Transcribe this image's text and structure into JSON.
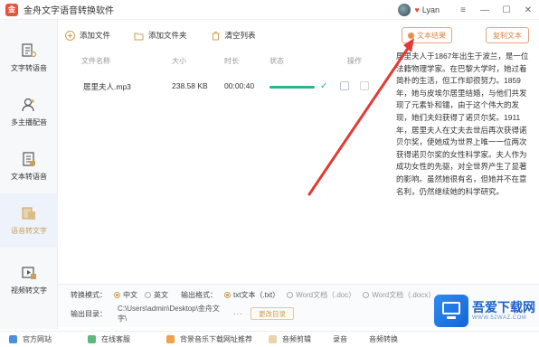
{
  "app": {
    "title": "金舟文字语音转换软件",
    "logo_glyph": "金",
    "username": "Lyan",
    "window_controls": {
      "menu": "≡",
      "minimize": "—",
      "maximize": "☐",
      "close": "✕"
    }
  },
  "sidebar": {
    "items": [
      {
        "label": "文字转语音",
        "icon": "text-to-speech-icon"
      },
      {
        "label": "多主播配音",
        "icon": "multi-anchor-icon"
      },
      {
        "label": "文本转语音",
        "icon": "text-file-icon"
      },
      {
        "label": "语音转文字",
        "icon": "speech-to-text-icon",
        "active": true
      },
      {
        "label": "视频转文字",
        "icon": "video-to-text-icon"
      }
    ]
  },
  "toolbar": {
    "add_file": "添加文件",
    "add_folder": "添加文件夹",
    "clear_list": "清空列表",
    "text_result": "文本结果",
    "copy_text": "复制文本"
  },
  "table": {
    "headers": [
      "文件名称",
      "大小",
      "时长",
      "状态",
      "操作"
    ],
    "rows": [
      {
        "name": "居里夫人.mp3",
        "size": "238.58 KB",
        "duration": "00:00:40",
        "progress": 1.0
      }
    ]
  },
  "result_text": "居里夫人于1867年出生于波兰，是一位法籍物理学家。在巴黎大学时，她过着简朴的生活，但工作却很努力。1859年，她与皮埃尔居里结婚，与他们共发现了元素钋和镭，由于这个伟大的发现，她们夫妇获得了诺贝尔奖。1911年，居里夫人在丈夫去世后再次获得诺贝尔奖，使她成为世界上唯一一位两次获得诺贝尔奖的女性科学家。夫人作为成功女性的先驱，对全世界产生了显著的影响。虽然她很有名，但她并不在意名利，仍然继续她的科学研究。",
  "settings": {
    "convert_mode_label": "转换模式：",
    "mode_chinese": "中文",
    "mode_english": "英文",
    "output_format_label": "输出格式：",
    "format_txt": "txt文本（.txt）",
    "format_doc": "Word文档（.doc）",
    "format_docx": "Word文档（.docx）",
    "output_dir_label": "输出目录：",
    "output_path": "C:\\Users\\admin\\Desktop\\金舟文字\\",
    "more": "···",
    "change_dir": "更改目录"
  },
  "statusbar": {
    "official_site": "官方网站",
    "online_service": "在线客服",
    "bg_music": "背景音乐下载网址推荐",
    "audio_edit": "音频剪辑",
    "recording": "录音",
    "audio_convert": "音频转换"
  },
  "watermark": {
    "title": "吾爱下载网",
    "subtitle": "WWW.52WAZ.COM"
  },
  "colors": {
    "accent": "#c9a15a",
    "orange": "#e8a37a",
    "green": "#2bb38a",
    "arrow": "#e23b35"
  }
}
